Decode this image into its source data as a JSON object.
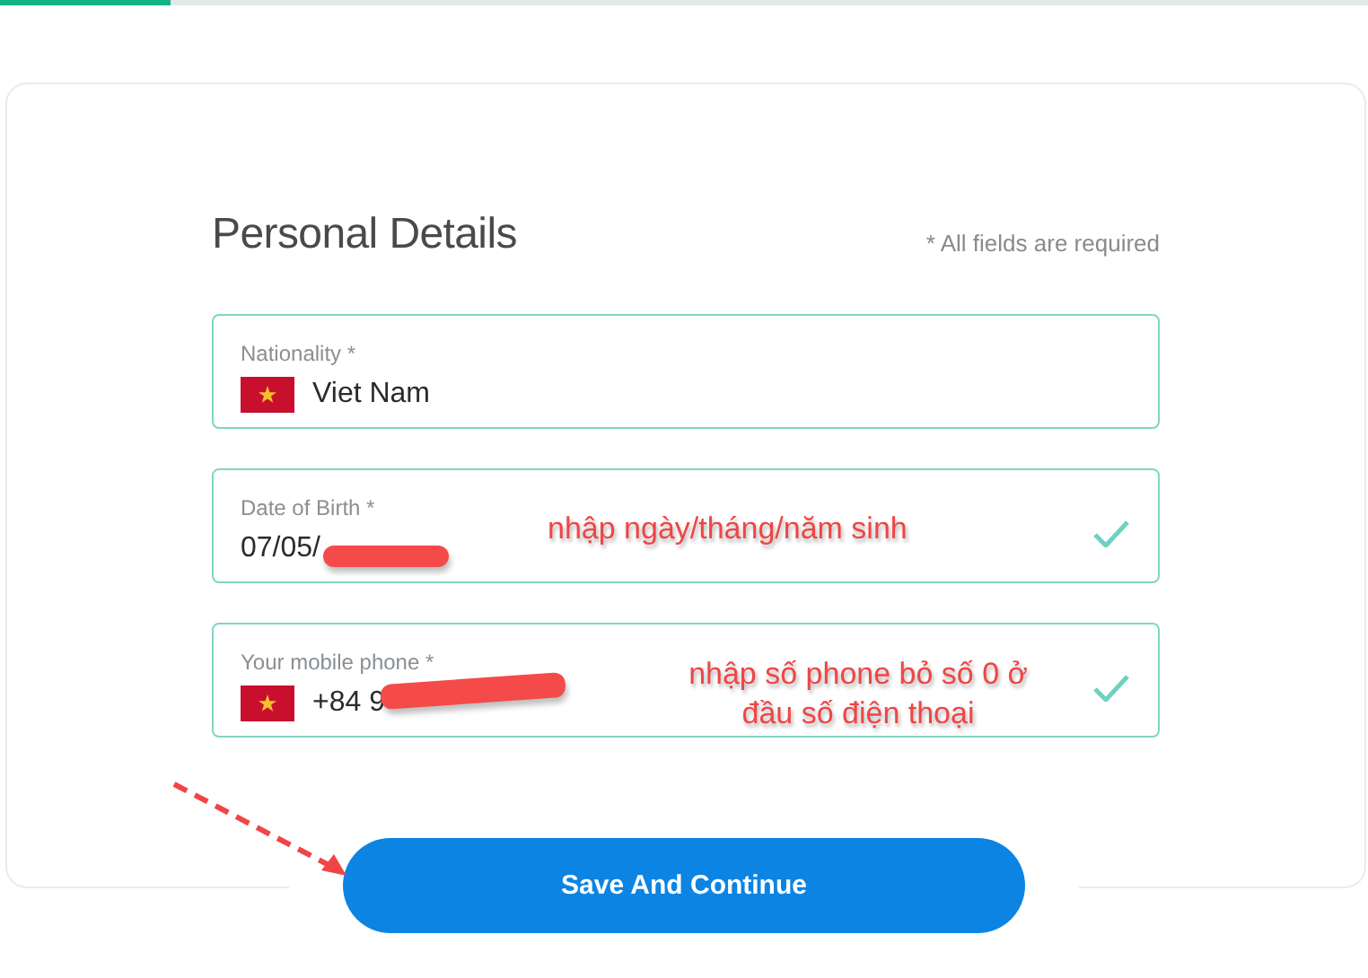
{
  "progress": {
    "level": 0.125
  },
  "form": {
    "title": "Personal Details",
    "note": "* All fields are required",
    "fields": [
      {
        "kind": "country",
        "label": "Nationality *",
        "flag": true,
        "value": "Viet Nam",
        "valid": false,
        "redacted": false
      },
      {
        "kind": "date",
        "label": "Date of Birth *",
        "value": "07/05/",
        "valid": true,
        "redacted": true,
        "annotation": "nhập ngày/tháng/năm sinh"
      },
      {
        "kind": "phone",
        "label": "Your mobile phone *",
        "flag": true,
        "value": "+84 9",
        "valid": true,
        "redacted": true,
        "annotation": "nhập số phone bỏ số 0 ở đầu số điện thoại"
      }
    ]
  },
  "button": {
    "label": "Save And Continue"
  }
}
